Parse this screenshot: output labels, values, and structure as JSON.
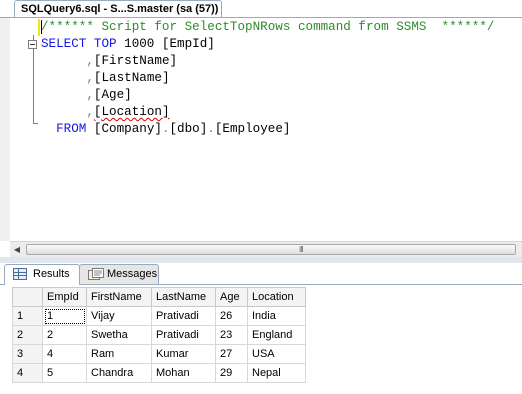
{
  "document_tab": {
    "title": "SQLQuery6.sql - S...S.master (sa (57))"
  },
  "editor": {
    "lines": [
      {
        "parts": [
          {
            "t": "cm",
            "v": "/****** Script for SelectTopNRows command from SSMS  ******/"
          }
        ]
      },
      {
        "parts": [
          {
            "t": "kw",
            "v": "SELECT TOP"
          },
          {
            "t": "tx",
            "v": " 1000 [EmpId]"
          }
        ]
      },
      {
        "parts": [
          {
            "t": "tx",
            "v": "      "
          },
          {
            "t": "gr",
            "v": ","
          },
          {
            "t": "tx",
            "v": "[FirstName]"
          }
        ]
      },
      {
        "parts": [
          {
            "t": "tx",
            "v": "      "
          },
          {
            "t": "gr",
            "v": ","
          },
          {
            "t": "tx",
            "v": "[LastName]"
          }
        ]
      },
      {
        "parts": [
          {
            "t": "tx",
            "v": "      "
          },
          {
            "t": "gr",
            "v": ","
          },
          {
            "t": "tx",
            "v": "[Age]"
          }
        ]
      },
      {
        "parts": [
          {
            "t": "tx",
            "v": "      "
          },
          {
            "t": "gr",
            "v": ","
          },
          {
            "t": "sq",
            "v": "[Location]"
          }
        ]
      },
      {
        "parts": [
          {
            "t": "tx",
            "v": "  "
          },
          {
            "t": "kw",
            "v": "FROM"
          },
          {
            "t": "tx",
            "v": " [Company]"
          },
          {
            "t": "gr",
            "v": "."
          },
          {
            "t": "tx",
            "v": "[dbo]"
          },
          {
            "t": "gr",
            "v": "."
          },
          {
            "t": "tx",
            "v": "[Employee]"
          }
        ]
      }
    ],
    "scrollbar_grip": "III"
  },
  "results": {
    "tabs": [
      {
        "label": "Results",
        "icon": "results-grid-icon",
        "active": true
      },
      {
        "label": "Messages",
        "icon": "messages-icon",
        "active": false
      }
    ],
    "columns": [
      "EmpId",
      "FirstName",
      "LastName",
      "Age",
      "Location"
    ],
    "rows": [
      {
        "num": "1",
        "cells": [
          "1",
          "Vijay",
          "Prativadi",
          "26",
          "India"
        ]
      },
      {
        "num": "2",
        "cells": [
          "2",
          "Swetha",
          "Prativadi",
          "23",
          "England"
        ]
      },
      {
        "num": "3",
        "cells": [
          "4",
          "Ram",
          "Kumar",
          "27",
          "USA"
        ]
      },
      {
        "num": "4",
        "cells": [
          "5",
          "Chandra",
          "Mohan",
          "29",
          "Nepal"
        ]
      }
    ]
  }
}
